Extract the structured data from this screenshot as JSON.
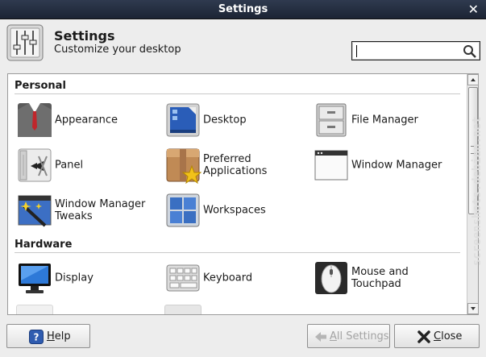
{
  "window": {
    "title": "Settings"
  },
  "header": {
    "title": "Settings",
    "subtitle": "Customize your desktop",
    "search_value": ""
  },
  "sections": [
    {
      "title": "Personal",
      "items": [
        {
          "label": "Appearance",
          "icon": "appearance-icon"
        },
        {
          "label": "Desktop",
          "icon": "desktop-icon"
        },
        {
          "label": "File Manager",
          "icon": "file-manager-icon"
        },
        {
          "label": "Panel",
          "icon": "panel-icon"
        },
        {
          "label": "Preferred\nApplications",
          "icon": "preferred-applications-icon"
        },
        {
          "label": "Window Manager",
          "icon": "window-manager-icon"
        },
        {
          "label": "Window Manager\nTweaks",
          "icon": "window-manager-tweaks-icon"
        },
        {
          "label": "Workspaces",
          "icon": "workspaces-icon"
        }
      ]
    },
    {
      "title": "Hardware",
      "items": [
        {
          "label": "Display",
          "icon": "display-icon"
        },
        {
          "label": "Keyboard",
          "icon": "keyboard-icon"
        },
        {
          "label": "Mouse and\nTouchpad",
          "icon": "mouse-icon"
        }
      ]
    }
  ],
  "footer": {
    "help": {
      "prefix": "",
      "mnemonic": "H",
      "rest": "elp"
    },
    "all_settings": {
      "mnemonic": "A",
      "rest": "ll Settings"
    },
    "close": {
      "mnemonic": "C",
      "rest": "lose"
    }
  },
  "watermark": "screenshots.debian.net",
  "colors": {
    "titlebar": "#1c2434",
    "accent": "#2f5cb0"
  }
}
